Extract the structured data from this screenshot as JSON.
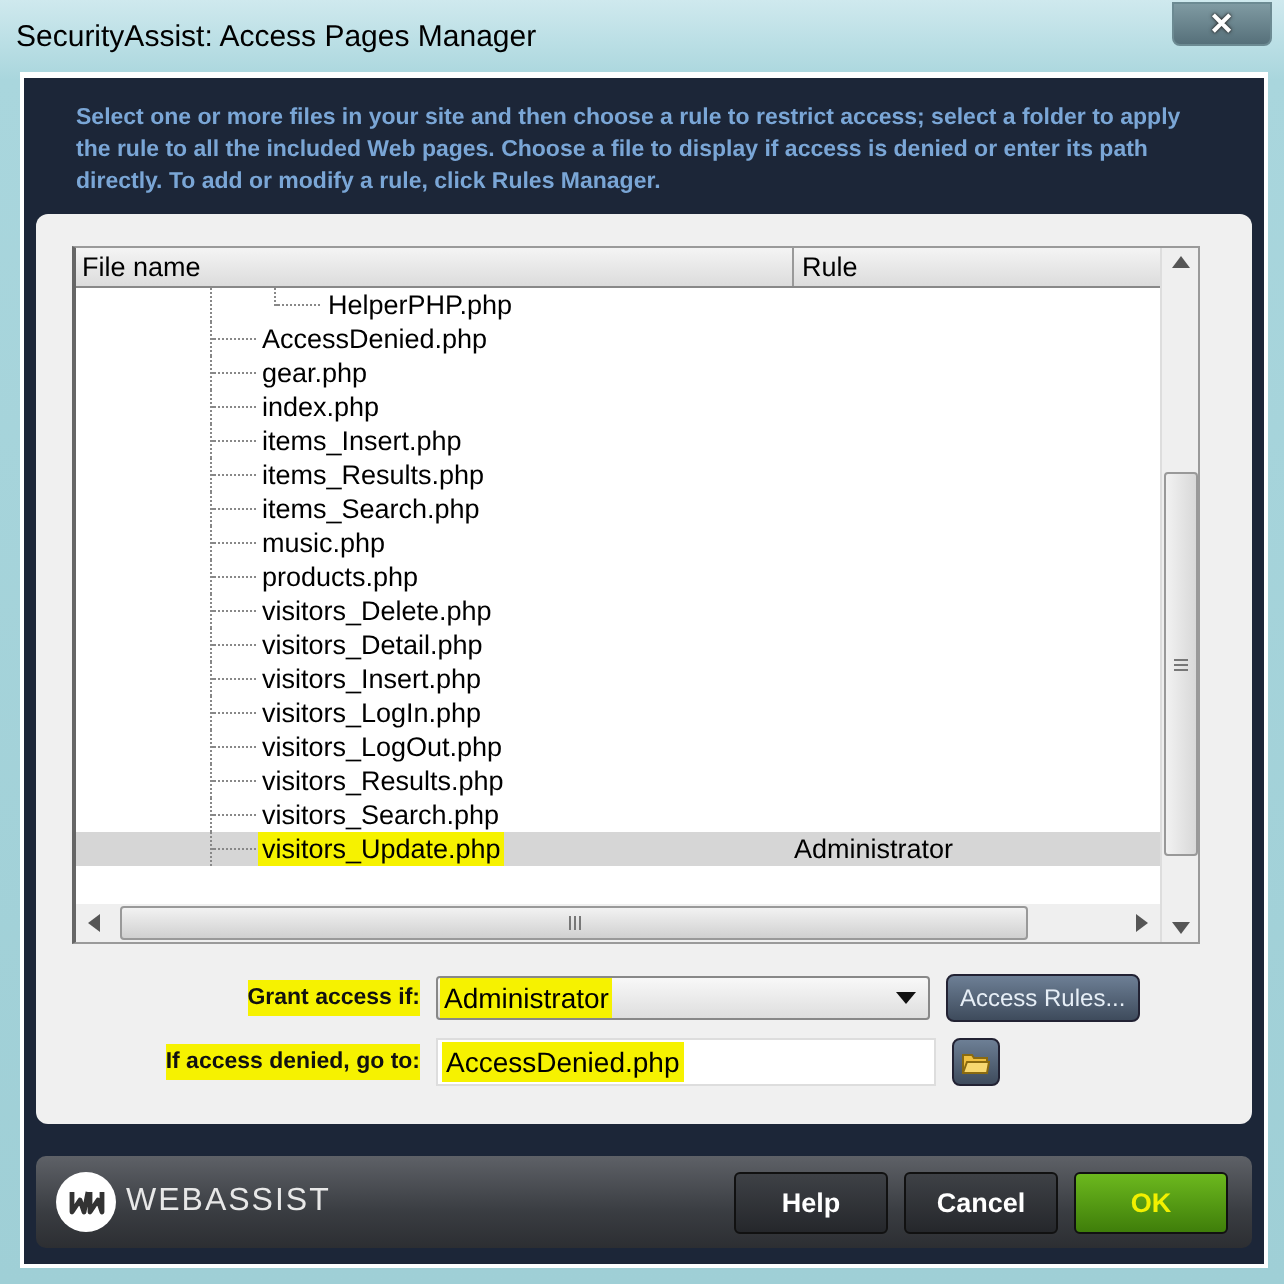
{
  "window": {
    "title": "SecurityAssist: Access Pages Manager",
    "close": "✕"
  },
  "description": "Select one or more files in your site and then choose a rule to restrict access; select a folder to apply the rule to all the included Web pages. Choose a file to display if access is denied or enter its path directly. To add or modify a rule, click Rules Manager.",
  "file_list": {
    "columns": [
      "File name",
      "Rule"
    ],
    "items": [
      {
        "children": [
          {
            "name": "HelperPHP.php",
            "selected": false,
            "highlighted": false
          }
        ]
      },
      {
        "name": "AccessDenied.php",
        "selected": false,
        "highlighted": false
      },
      {
        "name": "gear.php",
        "selected": false,
        "highlighted": false
      },
      {
        "name": "index.php",
        "selected": false,
        "highlighted": false
      },
      {
        "name": "items_Insert.php",
        "selected": false,
        "highlighted": false
      },
      {
        "name": "items_Results.php",
        "selected": false,
        "highlighted": false
      },
      {
        "name": "items_Search.php",
        "selected": false,
        "highlighted": false
      },
      {
        "name": "music.php",
        "selected": false,
        "highlighted": false
      },
      {
        "name": "products.php",
        "selected": false,
        "highlighted": false
      },
      {
        "name": "visitors_Delete.php",
        "selected": false,
        "highlighted": false
      },
      {
        "name": "visitors_Detail.php",
        "selected": false,
        "highlighted": false
      },
      {
        "name": "visitors_Insert.php",
        "selected": false,
        "highlighted": false
      },
      {
        "name": "visitors_LogIn.php",
        "selected": false,
        "highlighted": false
      },
      {
        "name": "visitors_LogOut.php",
        "selected": false,
        "highlighted": false
      },
      {
        "name": "visitors_Results.php",
        "selected": false,
        "highlighted": false
      },
      {
        "name": "visitors_Search.php",
        "selected": false,
        "highlighted": false
      },
      {
        "name": "visitors_Update.php",
        "rule": "Administrator",
        "selected": true,
        "highlighted": true
      }
    ]
  },
  "grant": {
    "label": "Grant access if:",
    "value": "Administrator",
    "label_highlighted": true,
    "value_highlighted": true,
    "button": "Access Rules..."
  },
  "denied": {
    "label": "If access denied, go to:",
    "value": "AccessDenied.php",
    "label_highlighted": true,
    "value_highlighted": true
  },
  "footer": {
    "logo": "WEBASSIST",
    "buttons": [
      {
        "label": "Help",
        "kind": "normal"
      },
      {
        "label": "Cancel",
        "kind": "normal"
      },
      {
        "label": "OK",
        "kind": "primary"
      }
    ]
  }
}
